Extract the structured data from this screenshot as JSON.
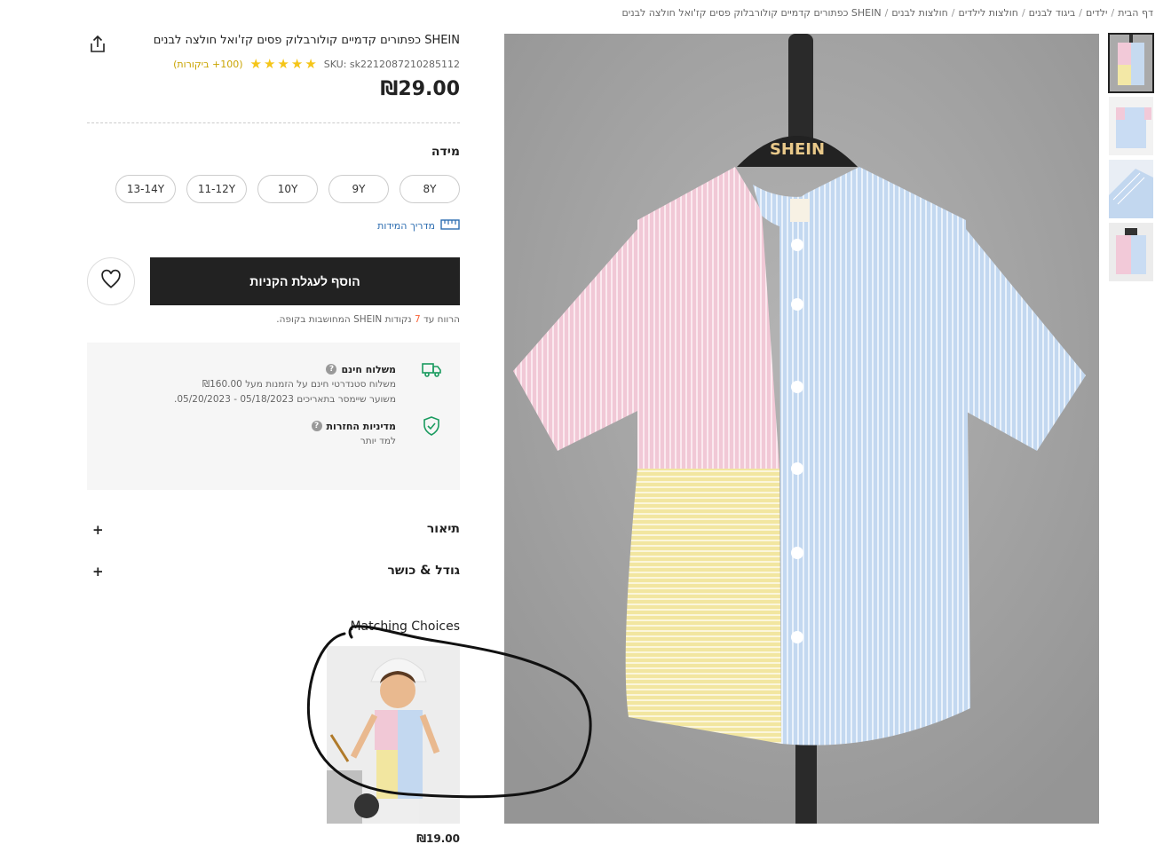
{
  "breadcrumb": {
    "items": [
      "דף הבית",
      "ילדים",
      "ביגוד לבנים",
      "חולצות לילדים",
      "חולצות לבנים",
      "SHEIN כפתורים קדמיים קולורבלוק פסים קז'ואל חולצה לבנים"
    ]
  },
  "product": {
    "title": "SHEIN כפתורים קדמיים קולורבלוק פסים קז'ואל חולצה לבנים",
    "sku": "SKU: sk2212087210285112",
    "reviews": "(100+ ביקורות)",
    "rating": 5,
    "price": "₪29.00",
    "hanger_brand": "SHEIN"
  },
  "size": {
    "label": "מידה",
    "options": [
      "8Y",
      "9Y",
      "10Y",
      "11-12Y",
      "13-14Y"
    ],
    "guide_label": "מדריך המידות"
  },
  "cart": {
    "add_label": "הוסף לעגלת הקניות",
    "points_prefix": "הרווח עד",
    "points_value": "7",
    "points_suffix": "נקודות SHEIN המחושבות בקופה."
  },
  "shipping": {
    "free_title": "משלוח חינם",
    "free_line1": "משלוח סטנדרטי חינם על הזמנות מעל ₪160.00",
    "free_line2": "משוער שיימסר בתאריכים 05/18/2023 - 05/20/2023.",
    "return_title": "מדיניות החזרות",
    "return_link": "למד יותר"
  },
  "accordion": {
    "description": "תיאור",
    "size_fit": "גודל & כושר",
    "plus": "+"
  },
  "matching": {
    "title": "Matching Choices",
    "price": "₪19.00"
  },
  "colors": {
    "accent_yellow": "#f5c518",
    "add_cart_bg": "#222222",
    "link_blue": "#2b6cb0",
    "points_orange": "#fa6338",
    "green_icon": "#1a9b5f"
  },
  "icons": {
    "share": "share-icon",
    "heart": "heart-icon",
    "truck": "truck-icon",
    "shield": "shield-check-icon",
    "ruler": "ruler-icon"
  }
}
